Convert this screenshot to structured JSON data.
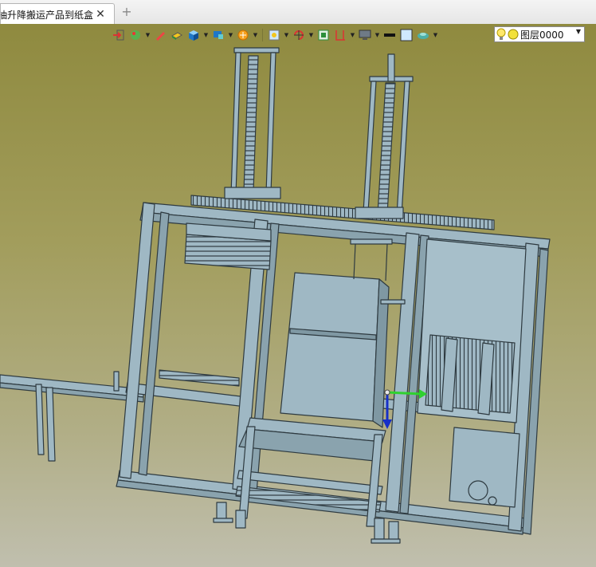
{
  "tab": {
    "title": "抽升降搬运产品到纸盒]",
    "close": "✕",
    "new": "+"
  },
  "toolbar": {
    "icons": [
      "exit-view-icon",
      "material-icon",
      "pen-icon",
      "part-icon",
      "cube-view-icon",
      "display-style-icon",
      "sun-icon",
      "zoom-fit-icon",
      "rotate-icon",
      "frame-icon",
      "dimension-icon",
      "monitor-icon",
      "line-color-icon",
      "fill-color-icon",
      "render-icon"
    ],
    "layer": {
      "label": "图层0000",
      "bulb": "on"
    }
  },
  "colors": {
    "viewport_top": "#8f8a3f",
    "viewport_bottom": "#c0bfae",
    "part": "#9fb8c4",
    "edge": "#2e3a40",
    "axis_green": "#2fd12f",
    "axis_blue": "#1730c8"
  }
}
